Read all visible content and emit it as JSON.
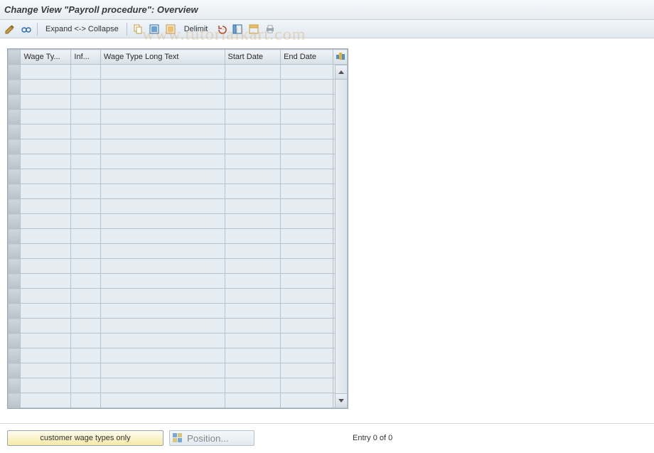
{
  "title": "Change View \"Payroll procedure\": Overview",
  "toolbar": {
    "expand_collapse_label": "Expand <-> Collapse",
    "delimit_label": "Delimit"
  },
  "table": {
    "columns": {
      "wage_type": "Wage Ty...",
      "inf": "Inf...",
      "wage_type_long": "Wage Type Long Text",
      "start_date": "Start Date",
      "end_date": "End Date"
    },
    "row_count_empty": 23
  },
  "footer": {
    "customer_button": "customer wage types only",
    "position_button": "Position...",
    "entry_text": "Entry 0 of 0"
  },
  "watermark": "www.tutorialkart.com",
  "colors": {
    "header_grad_top": "#f0f4f8",
    "header_grad_bot": "#d8e1e8",
    "cell_bg": "#e5ecf2",
    "accent_yellow": "#f6e9a6"
  }
}
